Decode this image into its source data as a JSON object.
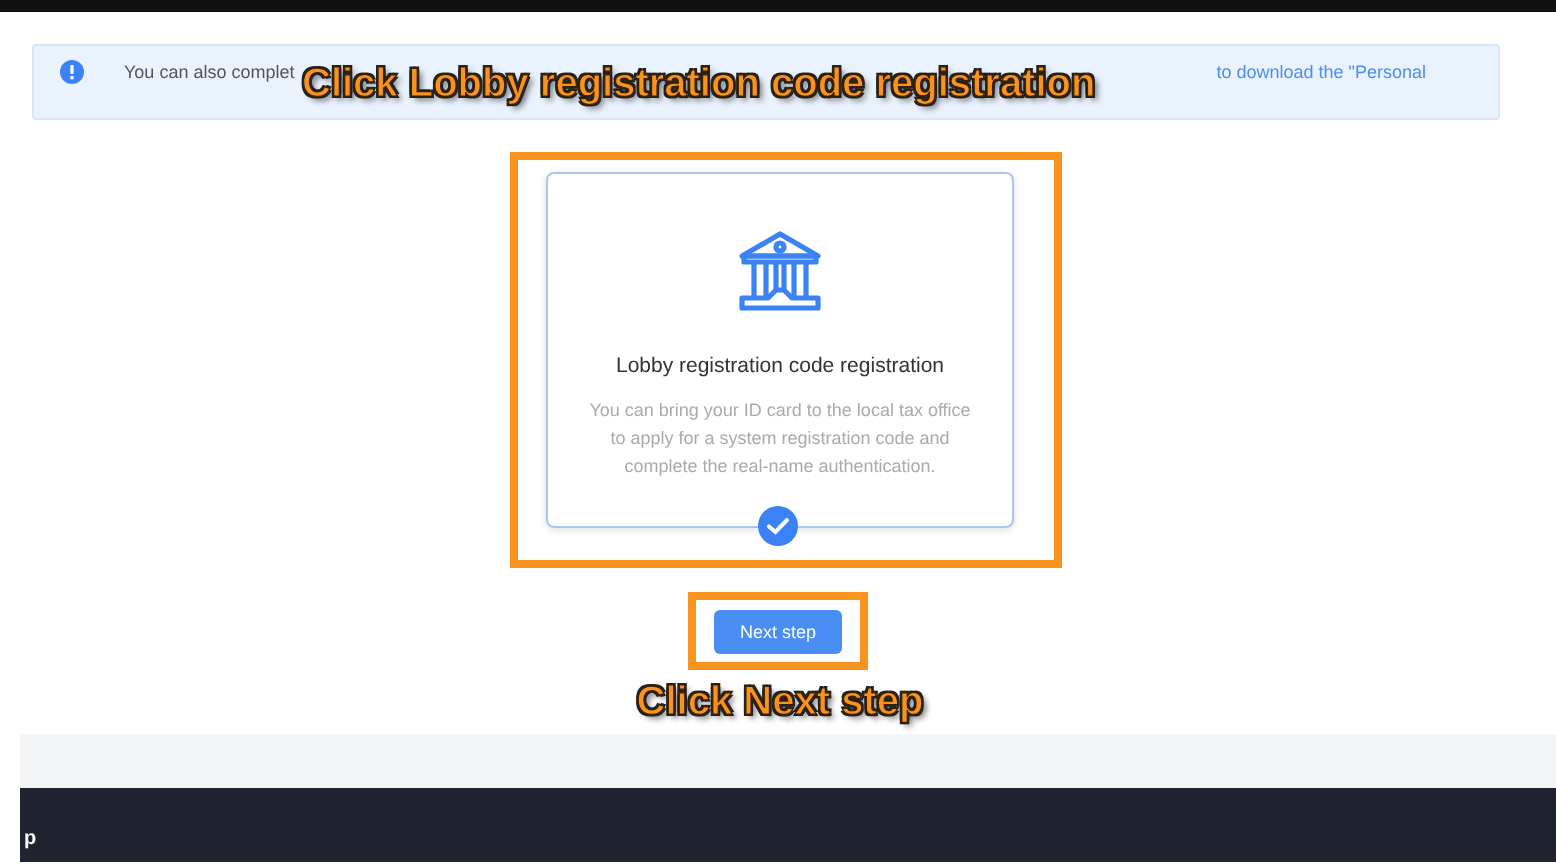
{
  "notice": {
    "text": "You can also complet",
    "link": "to download the \"Personal"
  },
  "option_card": {
    "title": "Lobby registration code registration",
    "description": "You can bring your ID card to the local tax office to apply for a system registration code and complete the real-name authentication.",
    "selected": true
  },
  "next_button": {
    "label": "Next step"
  },
  "annotations": [
    {
      "text": "Click Lobby registration code registration"
    },
    {
      "text": "Click Next step"
    }
  ],
  "footer": {
    "text": "p"
  }
}
